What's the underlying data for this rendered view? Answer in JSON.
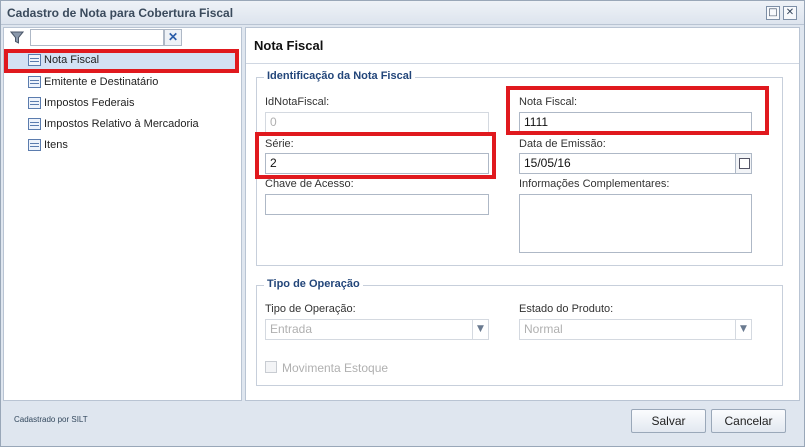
{
  "window": {
    "title": "Cadastro de Nota para Cobertura Fiscal",
    "maximize_glyph": "□",
    "close_glyph": "✕"
  },
  "sidebar": {
    "filter": {
      "value": "",
      "placeholder": "",
      "clear_glyph": "✕"
    },
    "items": [
      {
        "label": "Nota Fiscal",
        "selected": true,
        "icon": "form-icon"
      },
      {
        "label": "Emitente e Destinatário",
        "icon": "form-icon"
      },
      {
        "label": "Impostos Federais",
        "icon": "form-icon"
      },
      {
        "label": "Impostos Relativo à Mercadoria",
        "icon": "form-icon"
      },
      {
        "label": "Itens",
        "icon": "form-icon"
      }
    ]
  },
  "main": {
    "title": "Nota Fiscal",
    "identificacao": {
      "legend": "Identificação da Nota Fiscal",
      "id_label": "IdNotaFiscal:",
      "id_value": "0",
      "nota_label": "Nota Fiscal:",
      "nota_value": "1111",
      "serie_label": "Série:",
      "serie_value": "2",
      "data_label": "Data de Emissão:",
      "data_value": "15/05/16",
      "chave_label": "Chave de Acesso:",
      "chave_value": "",
      "info_label": "Informações Complementares:",
      "info_value": ""
    },
    "operacao": {
      "legend": "Tipo de Operação",
      "tipo_label": "Tipo de Operação:",
      "tipo_value": "Entrada",
      "estado_label": "Estado do Produto:",
      "estado_value": "Normal",
      "estoque_label": "Movimenta Estoque",
      "estoque_checked": false
    }
  },
  "footer": {
    "note": "Cadastrado por SILT",
    "save_label": "Salvar",
    "cancel_label": "Cancelar"
  },
  "colors": {
    "highlight": "#e0191e",
    "legend": "#23467a",
    "selection": "#d3e1f4"
  }
}
